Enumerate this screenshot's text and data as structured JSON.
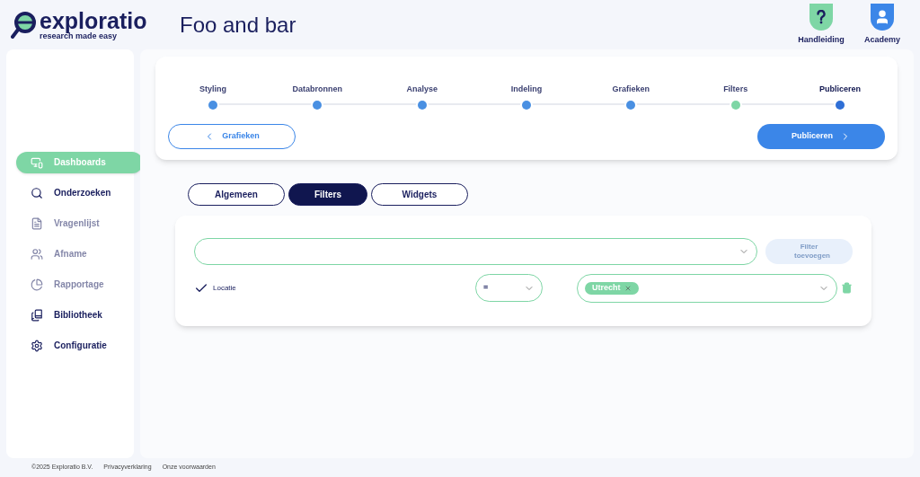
{
  "header": {
    "logo_word": "exploratio",
    "logo_tagline": "research made easy",
    "title": "Foo and bar",
    "help": [
      {
        "kind": "question",
        "label": "Handleiding"
      },
      {
        "kind": "person",
        "label": "Academy"
      }
    ]
  },
  "sidebar": {
    "items": [
      {
        "kind": "dashboard",
        "label": "Dashboards",
        "selected": true,
        "disabled": false
      },
      {
        "kind": "search",
        "label": "Onderzoeken",
        "selected": false,
        "disabled": false
      },
      {
        "kind": "document",
        "label": "Vragenlijst",
        "selected": false,
        "disabled": true
      },
      {
        "kind": "people",
        "label": "Afname",
        "selected": false,
        "disabled": true
      },
      {
        "kind": "pie",
        "label": "Rapportage",
        "selected": false,
        "disabled": true
      },
      {
        "kind": "library",
        "label": "Bibliotheek",
        "selected": false,
        "disabled": false
      },
      {
        "kind": "gears",
        "label": "Configuratie",
        "selected": false,
        "disabled": false
      }
    ]
  },
  "stepper": {
    "steps": [
      {
        "label": "Styling",
        "selected": false,
        "color": "#4a90e2"
      },
      {
        "label": "Databronnen",
        "selected": false,
        "color": "#4a90e2"
      },
      {
        "label": "Analyse",
        "selected": false,
        "color": "#4a90e2"
      },
      {
        "label": "Indeling",
        "selected": false,
        "color": "#4a90e2"
      },
      {
        "label": "Grafieken",
        "selected": false,
        "color": "#4a90e2"
      },
      {
        "label": "Filters",
        "selected": false,
        "color": "#7ed6a5"
      },
      {
        "label": "Publiceren",
        "selected": true,
        "color": "#2f6fd6"
      }
    ],
    "back_button": "Grafieken",
    "next_button": "Publiceren"
  },
  "tabs": [
    {
      "label": "Algemeen",
      "selected": false
    },
    {
      "label": "Filters",
      "selected": true
    },
    {
      "label": "Widgets",
      "selected": false
    }
  ],
  "filters": {
    "add_button": {
      "label": "Filter toevoegen",
      "disabled": true
    },
    "rows": [
      {
        "checked": true,
        "field": "Locatie",
        "operator": "=",
        "values": [
          "Utrecht"
        ]
      }
    ]
  },
  "footer": [
    "©2025 Exploratio B.V.",
    "Privacyverklaring",
    "Onze voorwaarden"
  ]
}
